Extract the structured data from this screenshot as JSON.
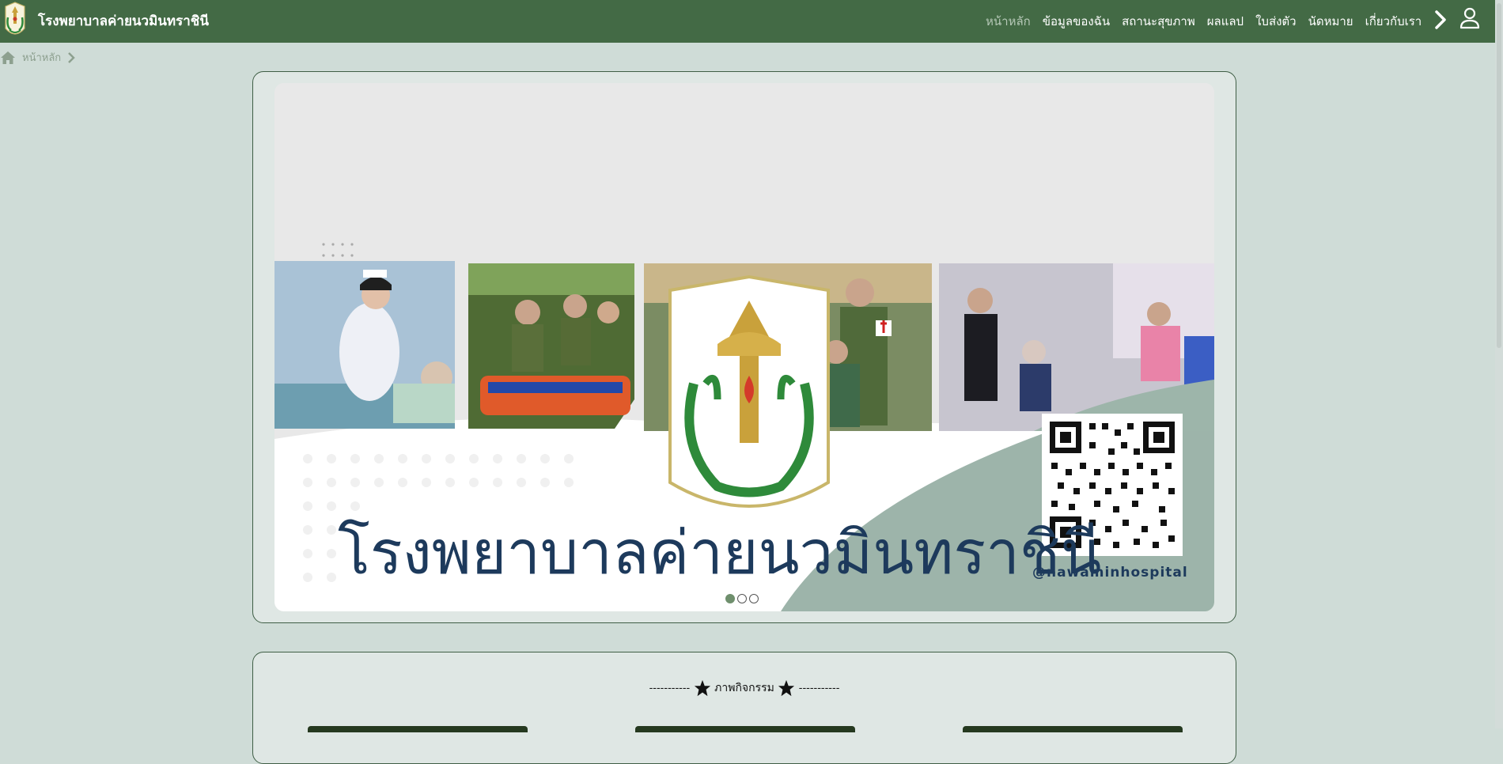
{
  "header": {
    "brand_title": "โรงพยาบาลค่ายนวมินทราชินี",
    "nav": [
      {
        "label": "หน้าหลัก",
        "active": true
      },
      {
        "label": "ข้อมูลของฉัน",
        "active": false
      },
      {
        "label": "สถานะสุขภาพ",
        "active": false
      },
      {
        "label": "ผลแลป",
        "active": false
      },
      {
        "label": "ใบส่งตัว",
        "active": false
      },
      {
        "label": "นัดหมาย",
        "active": false
      },
      {
        "label": "เกี่ยวกับเรา",
        "active": false
      }
    ],
    "icons": {
      "next": "chevron-right-icon",
      "user": "user-icon",
      "logo": "hospital-emblem"
    }
  },
  "breadcrumb": {
    "home_label": "หน้าหลัก"
  },
  "banner": {
    "headline": "โรงพยาบาลค่ายนวมินทราชินี",
    "handle": "@nawaminhospital",
    "slides_total": 3,
    "active_slide": 1
  },
  "activities": {
    "section_title": "ภาพกิจกรรม"
  },
  "colors": {
    "navbar": "#436a45",
    "background": "#cfdcd7",
    "card_bg": "#dfe7e4",
    "accent_green": "#9db5aa",
    "headline_navy": "#1d3a5c"
  }
}
